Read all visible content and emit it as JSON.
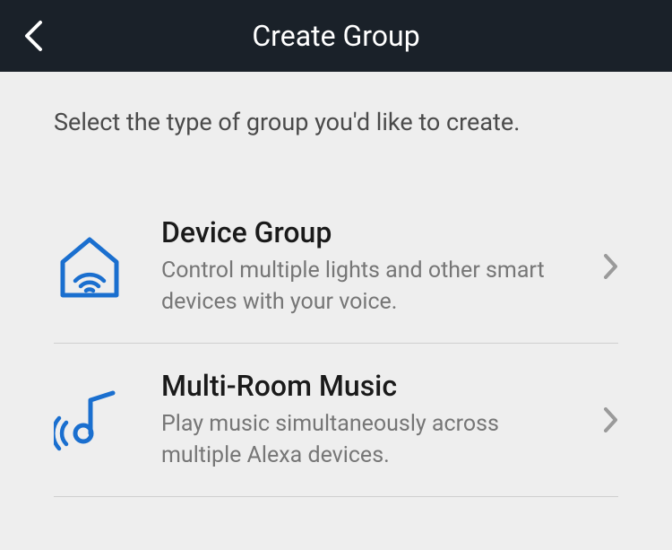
{
  "header": {
    "title": "Create Group"
  },
  "instruction": "Select the type of group you'd like to create.",
  "options": [
    {
      "icon_name": "smart-home-icon",
      "title": "Device Group",
      "subtitle": "Control multiple lights and other smart devices with your voice."
    },
    {
      "icon_name": "multi-room-music-icon",
      "title": "Multi-Room Music",
      "subtitle": "Play music simultaneously across multiple Alexa devices."
    }
  ]
}
